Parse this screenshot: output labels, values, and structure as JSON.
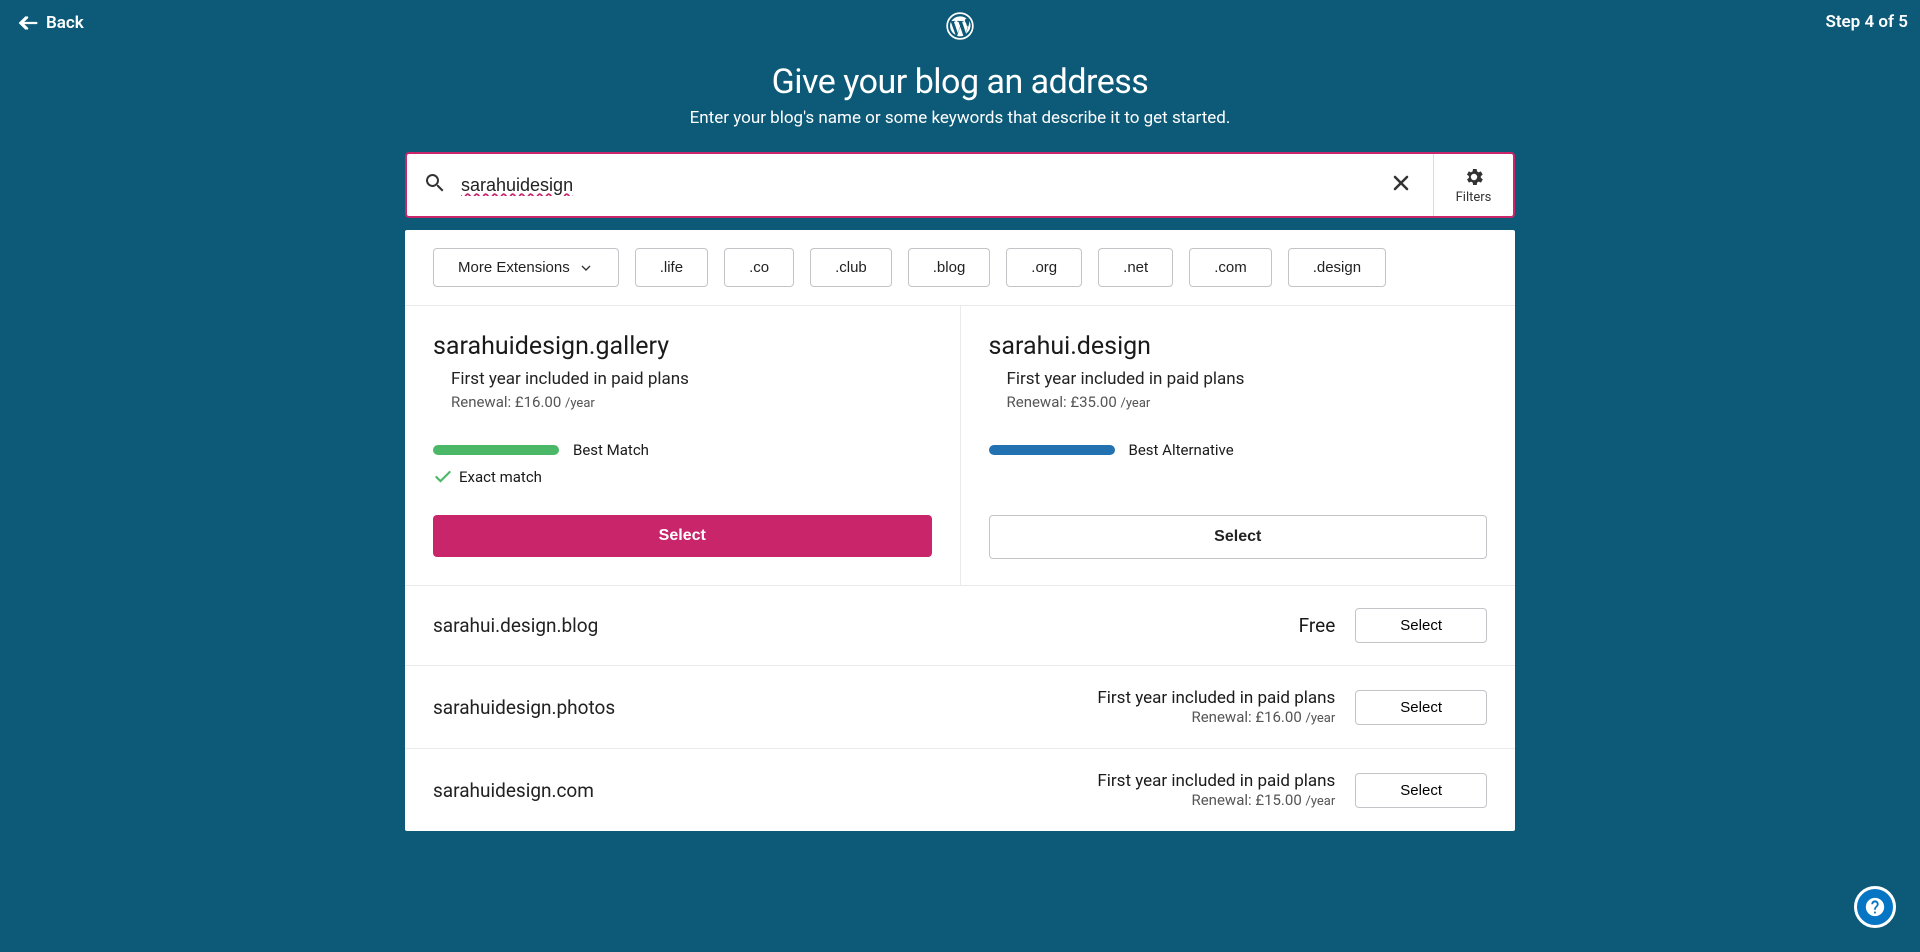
{
  "header": {
    "back_label": "Back",
    "step_text": "Step 4 of 5"
  },
  "title": {
    "main": "Give your blog an address",
    "sub": "Enter your blog's name or some keywords that describe it to get started."
  },
  "search": {
    "value": "sarahuidesign",
    "filters_label": "Filters"
  },
  "extensions": {
    "more_label": "More Extensions",
    "items": [
      ".life",
      ".co",
      ".club",
      ".blog",
      ".org",
      ".net",
      ".com",
      ".design"
    ]
  },
  "featured": [
    {
      "domain": "sarahuidesign.gallery",
      "plan_line": "First year included in paid plans",
      "renewal_prefix": "Renewal: £16.00 ",
      "renewal_suffix": "/year",
      "badge": "Best Match",
      "badge_color": "green",
      "exact": "Exact match",
      "select": "Select",
      "primary": true
    },
    {
      "domain": "sarahui.design",
      "plan_line": "First year included in paid plans",
      "renewal_prefix": "Renewal: £35.00 ",
      "renewal_suffix": "/year",
      "badge": "Best Alternative",
      "badge_color": "blue",
      "select": "Select",
      "primary": false
    }
  ],
  "list": [
    {
      "domain": "sarahui.design.blog",
      "free_label": "Free",
      "select": "Select"
    },
    {
      "domain": "sarahuidesign.photos",
      "plan_line": "First year included in paid plans",
      "renewal_prefix": "Renewal: £16.00 ",
      "renewal_suffix": "/year",
      "select": "Select"
    },
    {
      "domain": "sarahuidesign.com",
      "plan_line": "First year included in paid plans",
      "renewal_prefix": "Renewal: £15.00 ",
      "renewal_suffix": "/year",
      "select": "Select"
    }
  ]
}
